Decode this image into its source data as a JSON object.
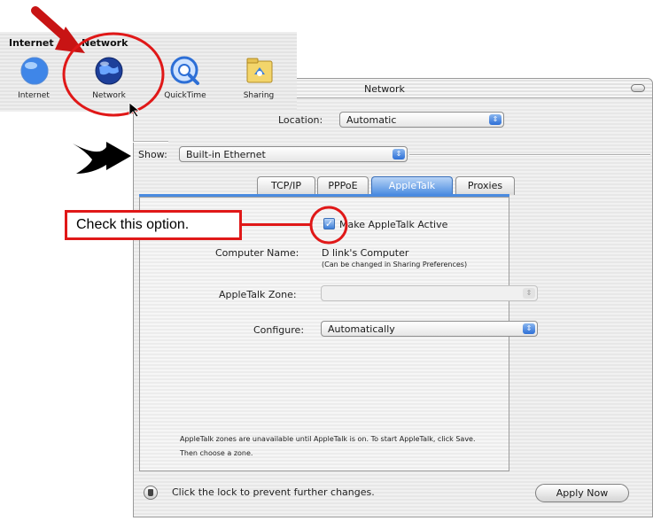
{
  "window": {
    "title": "Network"
  },
  "location": {
    "label": "Location:",
    "value": "Automatic"
  },
  "show": {
    "label": "Show:",
    "value": "Built-in Ethernet"
  },
  "tabs": [
    {
      "label": "TCP/IP",
      "selected": false
    },
    {
      "label": "PPPoE",
      "selected": false
    },
    {
      "label": "AppleTalk",
      "selected": true
    },
    {
      "label": "Proxies",
      "selected": false
    }
  ],
  "appletalk": {
    "checkbox_label": "Make AppleTalk Active",
    "checked": true,
    "computer_name_label": "Computer Name:",
    "computer_name_value": "D link's Computer",
    "computer_name_hint": "(Can be changed in Sharing Preferences)",
    "zone_label": "AppleTalk Zone:",
    "zone_value": "",
    "configure_label": "Configure:",
    "configure_value": "Automatically",
    "info_line1": "AppleTalk zones are unavailable until AppleTalk is on. To start AppleTalk, click Save.",
    "info_line2": "Then choose a zone."
  },
  "footer": {
    "lock_text": "Click the lock to prevent further changes.",
    "apply_label": "Apply Now"
  },
  "toolbar": {
    "heading_internet": "Internet",
    "heading_network": "Network",
    "items": [
      {
        "label": "Internet",
        "icon": "internet-globe-icon"
      },
      {
        "label": "Network",
        "icon": "network-globe-icon"
      },
      {
        "label": "QuickTime",
        "icon": "quicktime-icon"
      },
      {
        "label": "Sharing",
        "icon": "sharing-folder-icon"
      }
    ]
  },
  "annotation": {
    "callout_text": "Check this option."
  },
  "colors": {
    "annotation_red": "#e01818",
    "aqua_blue": "#4a8be0"
  }
}
